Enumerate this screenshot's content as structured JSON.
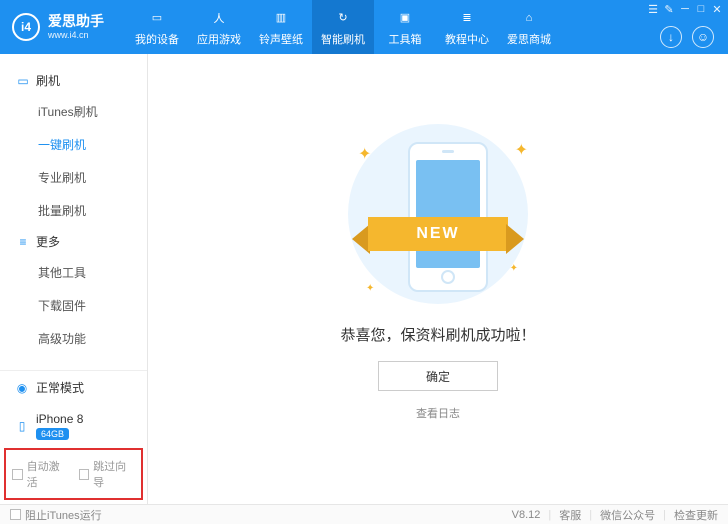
{
  "app": {
    "title": "爱思助手",
    "url": "www.i4.cn",
    "logo_short": "i4"
  },
  "nav": [
    {
      "label": "我的设备"
    },
    {
      "label": "应用游戏"
    },
    {
      "label": "铃声壁纸"
    },
    {
      "label": "智能刷机",
      "active": true
    },
    {
      "label": "工具箱"
    },
    {
      "label": "教程中心"
    },
    {
      "label": "爱思商城"
    }
  ],
  "sidebar": {
    "section1": {
      "title": "刷机",
      "items": [
        "iTunes刷机",
        "一键刷机",
        "专业刷机",
        "批量刷机"
      ],
      "active_index": 1
    },
    "section2": {
      "title": "更多",
      "items": [
        "其他工具",
        "下载固件",
        "高级功能"
      ]
    },
    "mode": "正常模式",
    "device": {
      "name": "iPhone 8",
      "storage": "64GB"
    },
    "auto_activate": "自动激活",
    "skip_guide": "跳过向导"
  },
  "main": {
    "ribbon": "NEW",
    "success": "恭喜您，保资料刷机成功啦！",
    "ok": "确定",
    "view_log": "查看日志"
  },
  "footer": {
    "block_itunes": "阻止iTunes运行",
    "version": "V8.12",
    "support": "客服",
    "wechat": "微信公众号",
    "check_update": "检查更新"
  }
}
